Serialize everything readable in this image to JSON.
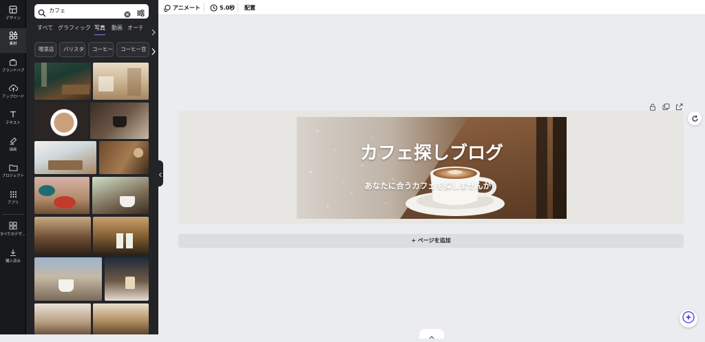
{
  "rail": {
    "items": [
      {
        "label": "デザイン",
        "icon": "layout-icon"
      },
      {
        "label": "素材",
        "icon": "elements-icon"
      },
      {
        "label": "ブランドハブ",
        "icon": "brand-icon"
      },
      {
        "label": "アップロード",
        "icon": "upload-icon"
      },
      {
        "label": "テキスト",
        "icon": "text-icon"
      },
      {
        "label": "描画",
        "icon": "draw-icon"
      },
      {
        "label": "プロジェクト",
        "icon": "folder-icon"
      },
      {
        "label": "アプリ",
        "icon": "apps-icon"
      },
      {
        "label": "すべてのデザ...",
        "icon": "all-designs-icon"
      },
      {
        "label": "購入済み",
        "icon": "download-icon"
      }
    ]
  },
  "search": {
    "value": "カフェ"
  },
  "tabs": [
    "すべて",
    "グラフィック",
    "写真",
    "動画",
    "オーデ"
  ],
  "chips": [
    "喫茶店",
    "バリスタ",
    "コーヒー",
    "コーヒー豆"
  ],
  "topbar": {
    "animate_label": "アニメート",
    "duration_label": "5.0秒",
    "position_label": "配置"
  },
  "canvas": {
    "banner_title": "カフェ探しブログ",
    "banner_subtitle": "あなたに合うカフェを探しませんか？",
    "add_page_label": "+ ページを追加"
  },
  "colors": {
    "accent": "#8b7df0",
    "sidebar_bg": "#18191b",
    "panel_bg": "#232427",
    "canvas_bg": "#ebecf0"
  }
}
